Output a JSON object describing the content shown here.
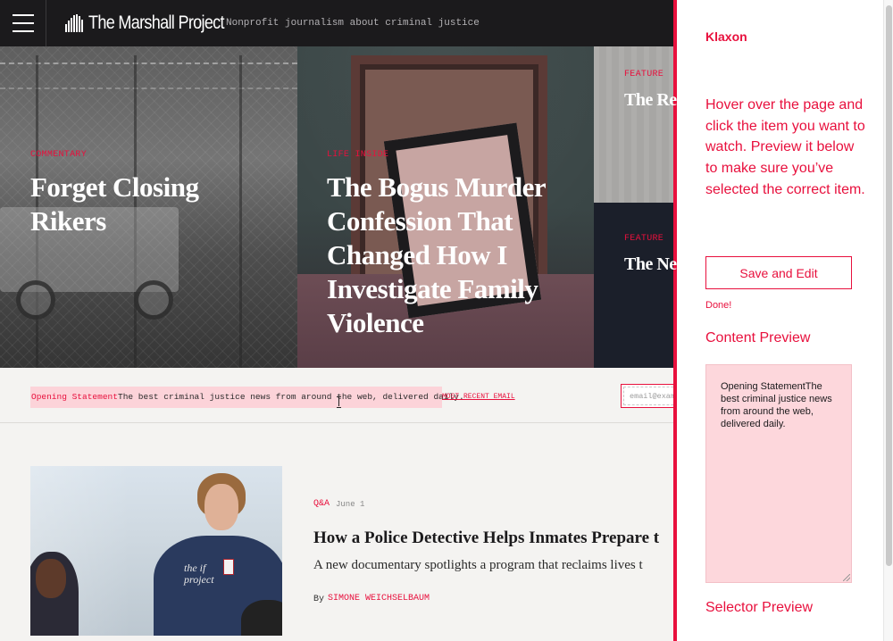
{
  "site": {
    "name": "The Marshall Project",
    "tagline": "Nonprofit journalism about criminal justice"
  },
  "hero": {
    "tiles": [
      {
        "kicker": "COMMENTARY",
        "title": "Forget Closing Rikers"
      },
      {
        "kicker": "LIFE INSIDE",
        "title": "The Bogus Murder Confession That Changed How I Investigate Family Violence"
      },
      {
        "kicker": "FEATURE",
        "title": "The Re"
      },
      {
        "kicker": "FEATURE",
        "title": "The Ne"
      }
    ]
  },
  "newsletter": {
    "label": "Opening Statement",
    "text": "The best criminal justice news from around the web, delivered daily.",
    "link": "MOST RECENT EMAIL",
    "email_placeholder": "email@exam"
  },
  "article": {
    "kicker": "Q&A",
    "date": "June 1",
    "title": "How a Police Detective Helps Inmates Prepare t",
    "dek": "A new documentary spotlights a program that reclaims lives t",
    "by": "By",
    "author": "SIMONE WEICHSELBAUM",
    "image_shirt_text": "the if project"
  },
  "klaxon": {
    "title": "Klaxon",
    "instructions": "Hover over the page and click the item you want to watch. Preview it below to make sure you’ve selected the correct item.",
    "save_button": "Save and Edit",
    "done": "Done!",
    "content_preview_heading": "Content Preview",
    "content_preview_text": "Opening StatementThe best criminal justice news from around the web, delivered daily.",
    "selector_preview_heading": "Selector Preview"
  },
  "colors": {
    "accent": "#e8103d",
    "nav_bg": "#1b1a1c",
    "highlight": "#fcd3d9"
  },
  "icons": [
    "hamburger-menu-icon",
    "logo-bars-icon",
    "text-cursor-icon",
    "resize-handle-icon"
  ]
}
